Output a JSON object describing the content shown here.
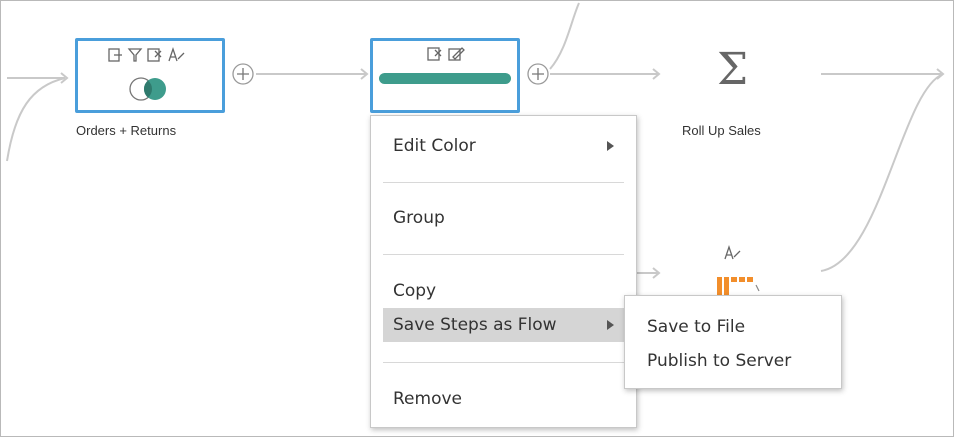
{
  "nodes": {
    "join": {
      "label": "Orders + Returns",
      "icons": [
        "output-icon",
        "filter-icon",
        "remove-field-icon",
        "rename-icon"
      ],
      "glyph": "venn-join-icon"
    },
    "clean": {
      "icons": [
        "remove-field-icon",
        "edit-icon"
      ],
      "bar_color": "#3e9c8c"
    },
    "aggregate": {
      "label": "Roll Up Sales",
      "glyph": "Σ"
    },
    "pivot": {
      "glyph": "pivot-icon"
    }
  },
  "context_menu": {
    "items": [
      {
        "label": "Edit Color",
        "submenu": true
      },
      {
        "label": "Group",
        "submenu": false
      },
      {
        "label": "Copy",
        "submenu": false
      },
      {
        "label": "Save Steps as Flow",
        "submenu": true
      },
      {
        "label": "Remove",
        "submenu": false
      }
    ]
  },
  "submenu": {
    "items": [
      {
        "label": "Save to File"
      },
      {
        "label": "Publish to Server"
      }
    ]
  },
  "colors": {
    "selection_border": "#4a9edb",
    "accent_teal": "#3e9c8c",
    "connector": "#c9c9c9",
    "pivot_orange": "#f28e2b"
  }
}
